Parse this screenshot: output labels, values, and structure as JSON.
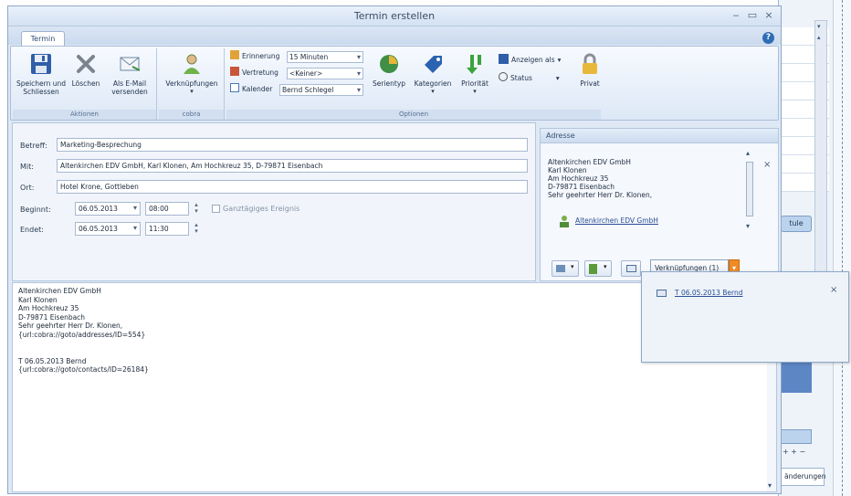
{
  "window": {
    "title": "Termin erstellen",
    "minimize": "‒",
    "maximize": "▭",
    "close": "×"
  },
  "tabs": [
    {
      "label": "Termin"
    }
  ],
  "help_glyph": "?",
  "ribbon": {
    "groups": {
      "aktionen": "Aktionen",
      "cobra": "cobra",
      "optionen": "Optionen"
    },
    "save": "Speichern und\nSchliessen",
    "delete": "Löschen",
    "email": "Als E-Mail\nversenden",
    "links": "Verknüpfungen",
    "reminder_label": "Erinnerung",
    "reminder_value": "15 Minuten",
    "deputy_label": "Vertretung",
    "deputy_value": "<Keiner>",
    "calendar_label": "Kalender",
    "calendar_value": "Bernd Schlegel",
    "series": "Serientyp",
    "categories": "Kategorien",
    "priority": "Priorität",
    "show_as": "Anzeigen als",
    "status": "Status",
    "private": "Privat"
  },
  "form": {
    "subject_label": "Betreff:",
    "subject_value": "Marketing-Besprechung",
    "with_label": "Mit:",
    "with_value": "Altenkirchen EDV GmbH, Karl Klonen, Am Hochkreuz 35, D-79871 Eisenbach",
    "location_label": "Ort:",
    "location_value": "Hotel Krone, Gottleben",
    "start_label": "Beginnt:",
    "start_date": "06.05.2013",
    "start_time": "08:00",
    "end_label": "Endet:",
    "end_date": "06.05.2013",
    "end_time": "11:30",
    "allday_label": "Ganztägiges Ereignis"
  },
  "address": {
    "header": "Adresse",
    "lines": [
      "Altenkirchen EDV GmbH",
      "Karl Klonen",
      "Am Hochkreuz 35",
      "D-79871 Eisenbach",
      "Sehr geehrter Herr Dr. Klonen,"
    ],
    "link": "Altenkirchen EDV GmbH",
    "links_button": "Verknüpfungen (1)"
  },
  "notes": "Altenkirchen EDV GmbH\nKarl Klonen\nAm Hochkreuz 35\nD-79871 Eisenbach\nSehr geehrter Herr Dr. Klonen,\n{url:cobra://goto/addresses/ID=554}\n\n\nT 06.05.2013 Bernd\n{url:cobra://goto/contacts/ID=26184}",
  "popup": {
    "link": "T 06.05.2013 Bernd",
    "close": "×"
  },
  "background": {
    "button": "tule",
    "footer": "änderungen",
    "nav": "+ + −"
  },
  "colors": {
    "accent": "#f08a24",
    "ribbon_blue": "#2f6db5",
    "link": "#2a4f93"
  }
}
